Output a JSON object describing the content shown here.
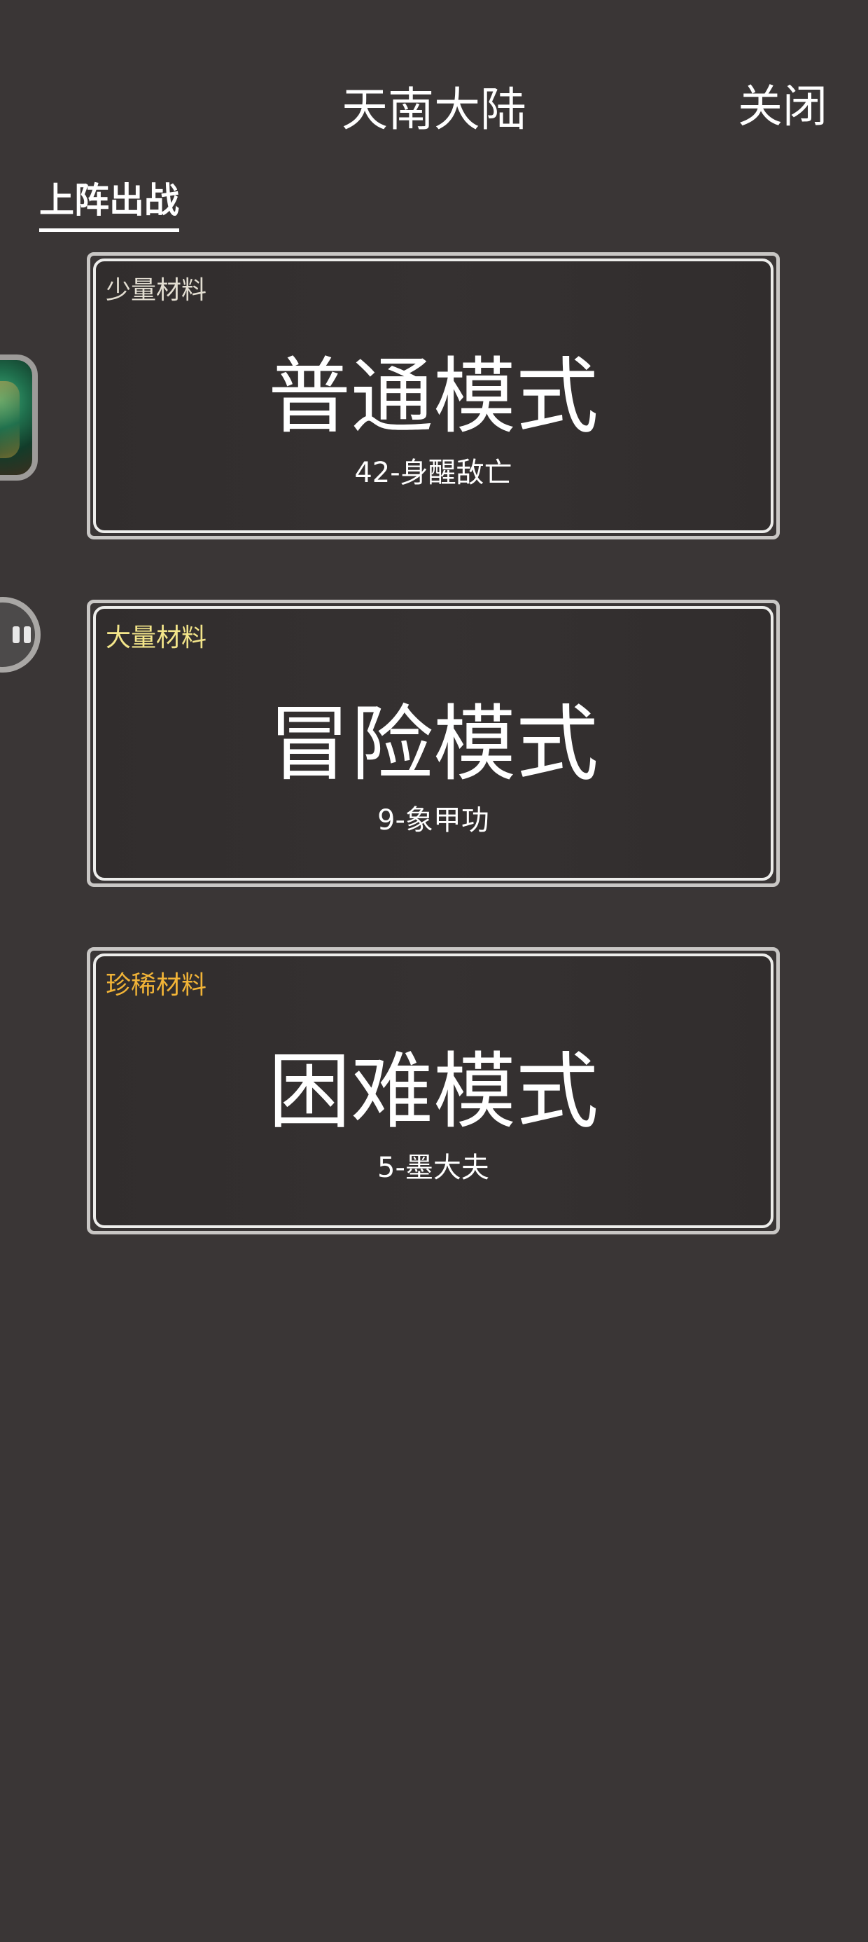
{
  "header": {
    "title": "天南大陆",
    "close_label": "关闭"
  },
  "tabs": {
    "active_label": "上阵出战"
  },
  "modes": [
    {
      "material": "少量材料",
      "material_color": "#e3ded2",
      "title": "普通模式",
      "subtitle": "42-身醒敌亡"
    },
    {
      "material": "大量材料",
      "material_color": "#f3e58a",
      "title": "冒险模式",
      "subtitle": "9-象甲功"
    },
    {
      "material": "珍稀材料",
      "material_color": "#f2b437",
      "title": "困难模式",
      "subtitle": "5-墨大夫"
    }
  ],
  "side": {
    "avatar_icon": "character-portrait-icon",
    "chat_icon": "chat-bubble-icon"
  }
}
